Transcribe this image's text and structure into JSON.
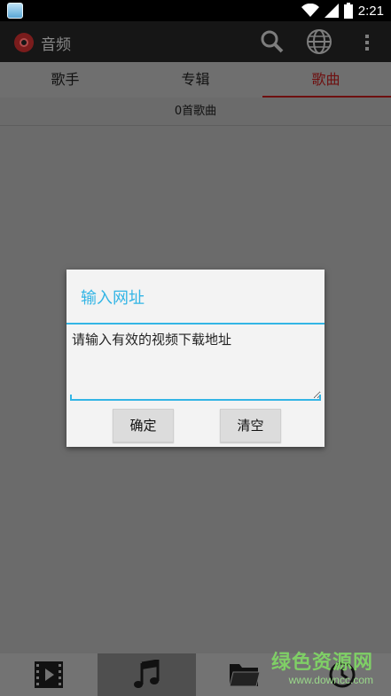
{
  "status_bar": {
    "time": "2:21"
  },
  "action_bar": {
    "title": "音频",
    "actions": [
      "search-icon",
      "globe-icon",
      "more-icon"
    ]
  },
  "tabs": [
    {
      "label": "歌手",
      "active": false
    },
    {
      "label": "专辑",
      "active": false
    },
    {
      "label": "歌曲",
      "active": true
    }
  ],
  "song_count": "0首歌曲",
  "dialog": {
    "title": "输入网址",
    "input_placeholder": "请输入有效的视频下载地址",
    "input_value": "",
    "ok_label": "确定",
    "clear_label": "清空"
  },
  "bottom_nav": [
    {
      "icon": "video-icon",
      "active": false
    },
    {
      "icon": "music-icon",
      "active": true
    },
    {
      "icon": "folder-icon",
      "active": false
    },
    {
      "icon": "history-icon",
      "active": false
    }
  ],
  "watermark": {
    "line1": "绿色资源网",
    "line2": "www.downcc.com"
  },
  "colors": {
    "accent": "#33b5e5",
    "active_tab": "#6e1010",
    "dim_bg": "#6b6b6b"
  }
}
